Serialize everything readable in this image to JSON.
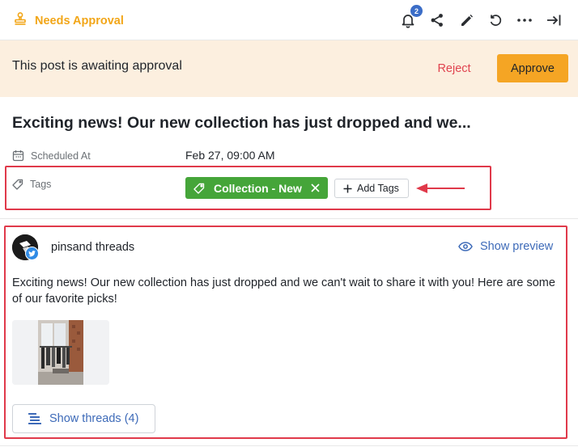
{
  "header": {
    "status_label": "Needs Approval",
    "notification_count": "2",
    "icons": [
      "stamp-icon",
      "bell-icon",
      "share-icon",
      "pencil-icon",
      "undo-icon",
      "more-horizontal-icon",
      "collapse-right-icon"
    ]
  },
  "banner": {
    "message": "This post is awaiting approval",
    "reject_label": "Reject",
    "approve_label": "Approve"
  },
  "post": {
    "title": "Exciting news! Our new collection has just dropped and we...",
    "scheduled_label": "Scheduled At",
    "scheduled_value": "Feb 27, 09:00 AM",
    "tags_label": "Tags",
    "tags": [
      "Collection - New"
    ],
    "add_tags_label": "Add Tags"
  },
  "card": {
    "account_name": "pinsand threads",
    "show_preview_label": "Show preview",
    "body": "Exciting news! Our new collection has just dropped and we can't wait to share it with you! Here are some of our favorite picks!",
    "show_threads_label": "Show threads (4)"
  },
  "colors": {
    "status": "#f2a618",
    "banner_bg": "#fcefdf",
    "approve": "#f5a524",
    "reject": "#e0434f",
    "tag": "#45a539",
    "link": "#3d6ab8",
    "highlight": "#e0394a",
    "badge": "#3b6dc7"
  }
}
